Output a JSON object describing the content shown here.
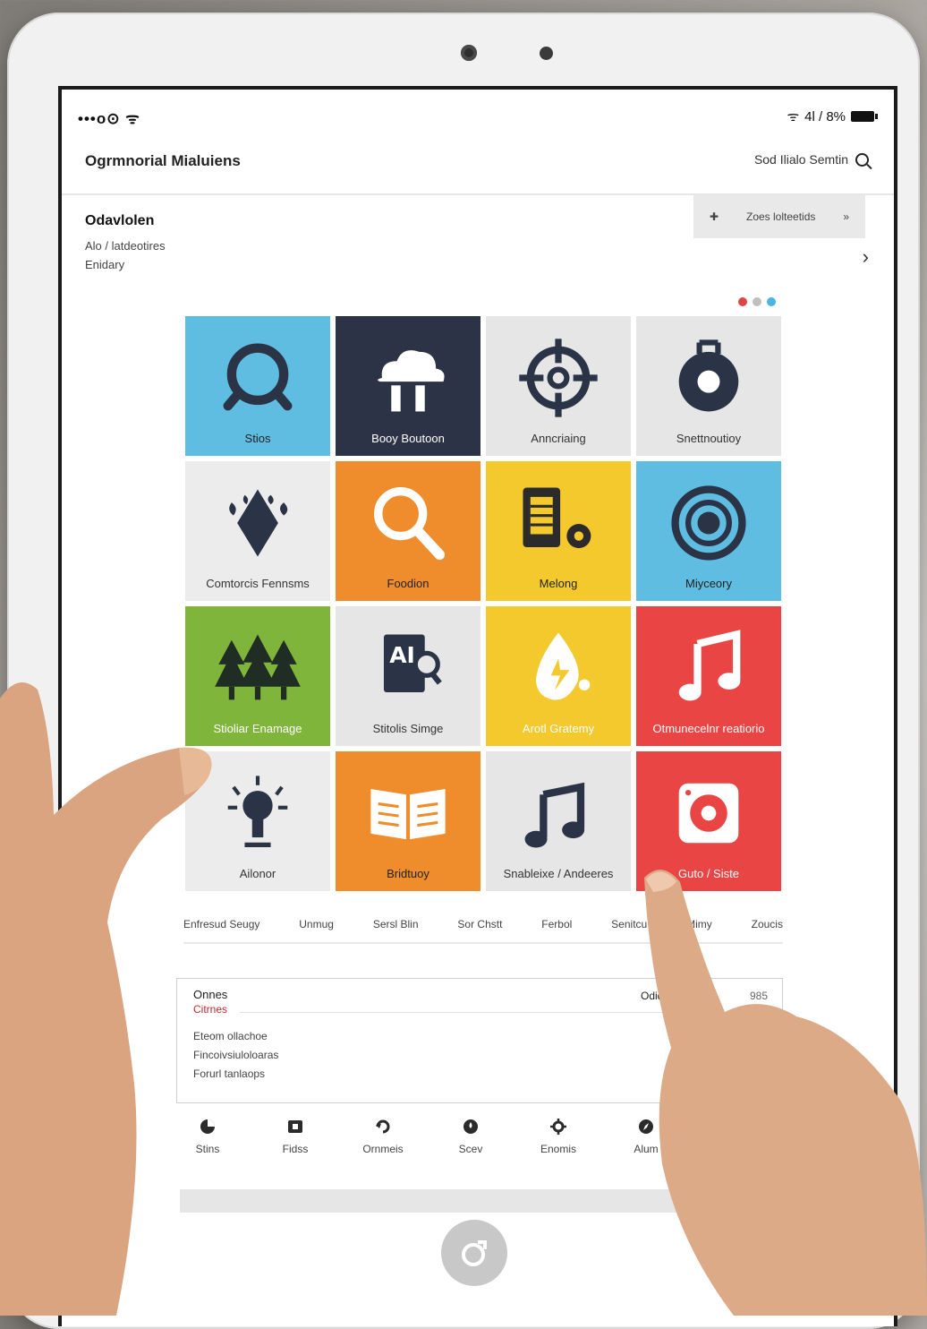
{
  "status_bar": {
    "left": "•••o⊙ ᯤ",
    "right": "4l / 8%"
  },
  "app": {
    "title": "Ogrmnorial Mialuiens",
    "search_label": "Sod Ilialo Semtin"
  },
  "overview": {
    "title": "Odavlolen",
    "lines": [
      "Alo / latdeotires",
      "Enidary"
    ]
  },
  "quick_action": {
    "label": "Zoes lolteetids",
    "left_icon": "plus-icon",
    "right_icon": "arrow-icon"
  },
  "carousel": {
    "dot_colors": [
      "#e04545",
      "#bfbfbf",
      "#4ab6df"
    ]
  },
  "tiles": [
    {
      "label": "Stios",
      "icon": "search-circle-icon",
      "bg": "#5fbde2",
      "fg": "#2b3446",
      "text": "#222"
    },
    {
      "label": "Booy Boutoon",
      "icon": "cloud-icon",
      "bg": "#2d3346",
      "fg": "#ffffff",
      "text": "#fff"
    },
    {
      "label": "Anncriaing",
      "icon": "crosshair-icon",
      "bg": "#e6e6e6",
      "fg": "#2b3446",
      "text": "#333"
    },
    {
      "label": "Snettnoutioy",
      "icon": "gauge-icon",
      "bg": "#e6e6e6",
      "fg": "#2b3446",
      "text": "#333"
    },
    {
      "label": "Comtorcis Fennsms",
      "icon": "leaf-icon",
      "bg": "#ececec",
      "fg": "#2b3446",
      "text": "#333"
    },
    {
      "label": "Foodion",
      "icon": "magnifier-icon",
      "bg": "#ef8c2b",
      "fg": "#ffffff",
      "text": "#222"
    },
    {
      "label": "Melong",
      "icon": "device-gear-icon",
      "bg": "#f3c92d",
      "fg": "#2b2b2b",
      "text": "#222"
    },
    {
      "label": "Miyceory",
      "icon": "target-icon",
      "bg": "#5fbde2",
      "fg": "#2b3446",
      "text": "#222"
    },
    {
      "label": "Stioliar Enamage",
      "icon": "trees-icon",
      "bg": "#7fb53a",
      "fg": "#1f2d24",
      "text": "#fff"
    },
    {
      "label": "Stitolis Simge",
      "icon": "document-search-icon",
      "bg": "#e6e6e6",
      "fg": "#2b3446",
      "text": "#333"
    },
    {
      "label": "Arotl Gratemy",
      "icon": "drop-bolt-icon",
      "bg": "#f3c92d",
      "fg": "#ffffff",
      "text": "#fff"
    },
    {
      "label": "Otmunecelnr reatiorio",
      "icon": "music-note-icon",
      "bg": "#e94545",
      "fg": "#ffffff",
      "text": "#fff"
    },
    {
      "label": "Ailonor",
      "icon": "lightbulb-icon",
      "bg": "#ececec",
      "fg": "#2b3446",
      "text": "#333"
    },
    {
      "label": "Bridtuoy",
      "icon": "book-icon",
      "bg": "#ef8c2b",
      "fg": "#ffffff",
      "text": "#222"
    },
    {
      "label": "Snableixe / Andeeres",
      "icon": "music-notes-icon",
      "bg": "#e6e6e6",
      "fg": "#2b3446",
      "text": "#333"
    },
    {
      "label": "Guto / Siste",
      "icon": "speaker-icon",
      "bg": "#e94545",
      "fg": "#ffffff",
      "text": "#fff"
    }
  ],
  "tabs": [
    "Enfresud Seugy",
    "Unmug",
    "Sersl Blin",
    "Sor Chstt",
    "Ferbol",
    "Senitcu",
    "Mimy",
    "Zoucis"
  ],
  "panel": {
    "title": "Onnes",
    "subtitle": "Citrnes",
    "right_label": "Odid",
    "number": "985",
    "items": [
      "Eteom ollachoe",
      "Fincoivsiuloloaras",
      "Forurl tanlaops"
    ]
  },
  "dock": [
    {
      "label": "Stins",
      "icon": "pie-icon"
    },
    {
      "label": "Fidss",
      "icon": "square-icon"
    },
    {
      "label": "Ornmeis",
      "icon": "refresh-icon"
    },
    {
      "label": "Scev",
      "icon": "drop-icon"
    },
    {
      "label": "Enomis",
      "icon": "gear-icon"
    },
    {
      "label": "Alum",
      "icon": "compass-icon"
    }
  ],
  "home_icon": "home-swirl-icon"
}
